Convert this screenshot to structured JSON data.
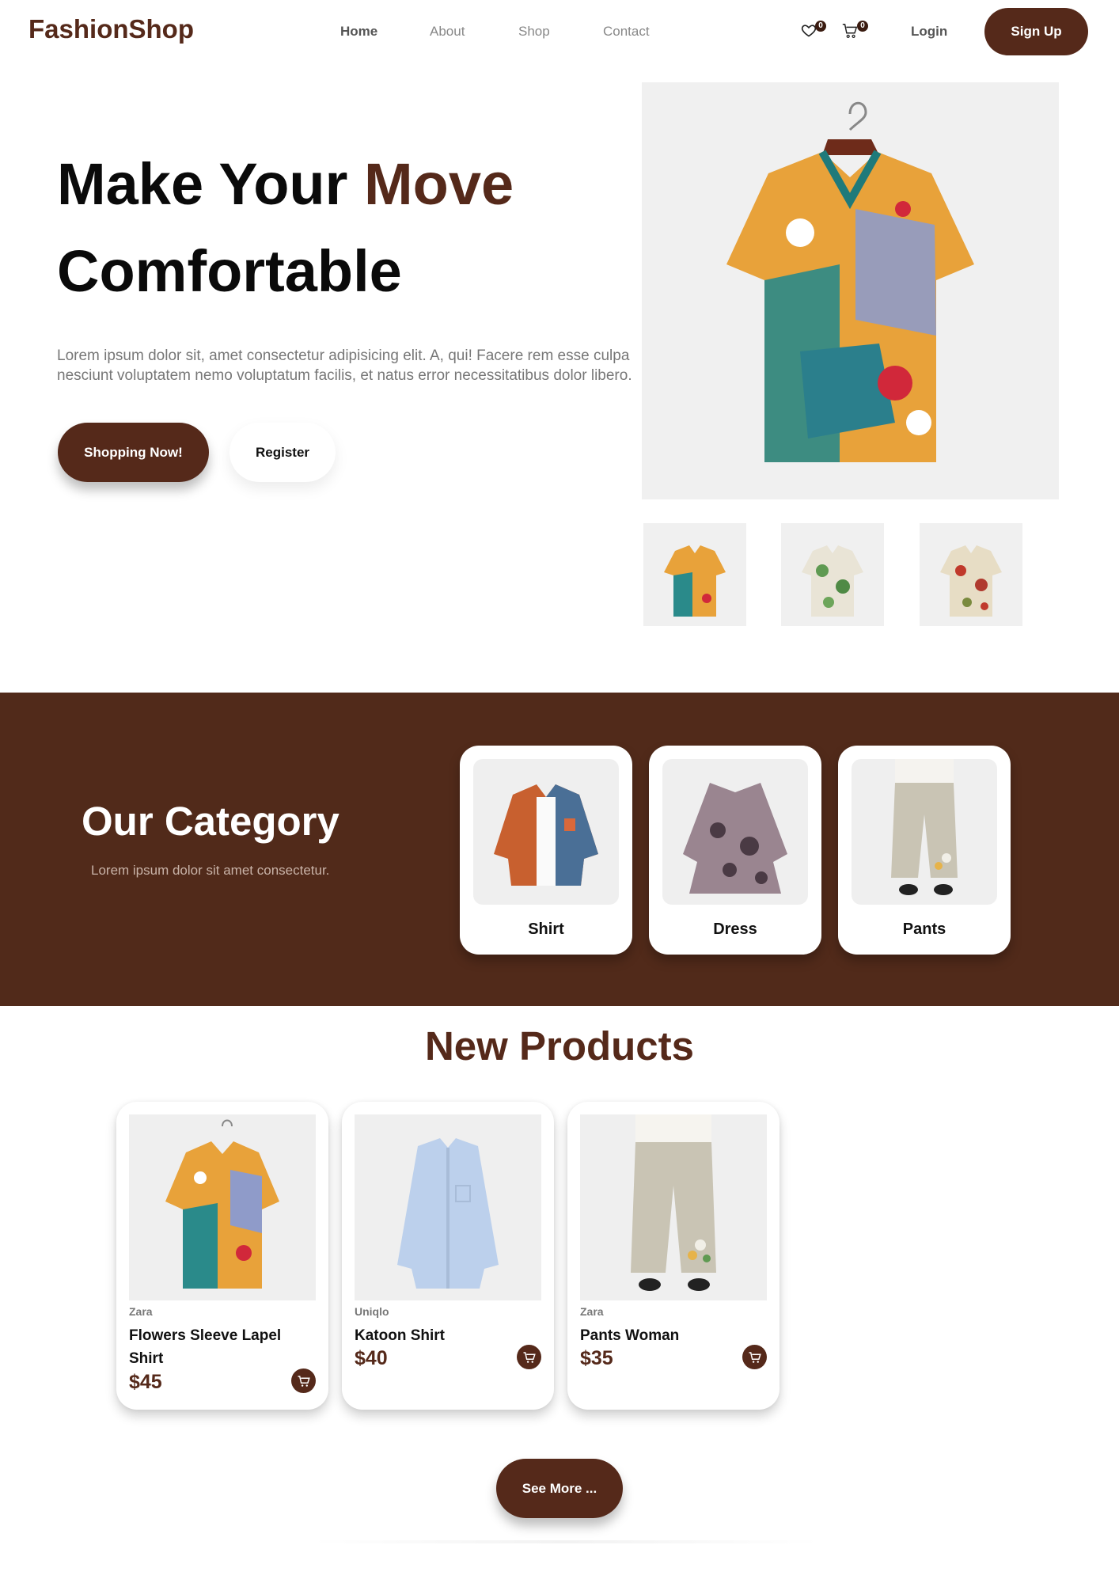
{
  "nav": {
    "logo": "FashionShop",
    "links": [
      "Home",
      "About",
      "Shop",
      "Contact"
    ],
    "wishlist_count": "0",
    "cart_count": "0",
    "login": "Login",
    "signup": "Sign Up"
  },
  "hero": {
    "title_line1_part1": "Make Your ",
    "title_line1_accent": "Move",
    "title_line2": "Comfortable",
    "description": "Lorem ipsum dolor sit, amet consectetur adipisicing elit. A, qui! Facere rem esse culpa nesciunt voluptatem nemo voluptatum facilis, et natus error necessitatibus dolor libero.",
    "primary_button": "Shopping Now!",
    "secondary_button": "Register"
  },
  "category": {
    "title": "Our Category",
    "subtitle": "Lorem ipsum dolor sit amet consectetur.",
    "items": [
      {
        "label": "Shirt"
      },
      {
        "label": "Dress"
      },
      {
        "label": "Pants"
      }
    ]
  },
  "products": {
    "title": "New Products",
    "items": [
      {
        "brand": "Zara",
        "name": "Flowers Sleeve Lapel Shirt",
        "price": "$45"
      },
      {
        "brand": "Uniqlo",
        "name": "Katoon Shirt",
        "price": "$40"
      },
      {
        "brand": "Zara",
        "name": "Pants Woman",
        "price": "$35"
      }
    ],
    "see_more": "See More ..."
  },
  "colors": {
    "brand": "#55291a",
    "band": "#512a1a",
    "muted": "#777777"
  },
  "icons": [
    "heart-icon",
    "cart-icon",
    "shirt-icon",
    "dress-icon",
    "pants-icon"
  ]
}
